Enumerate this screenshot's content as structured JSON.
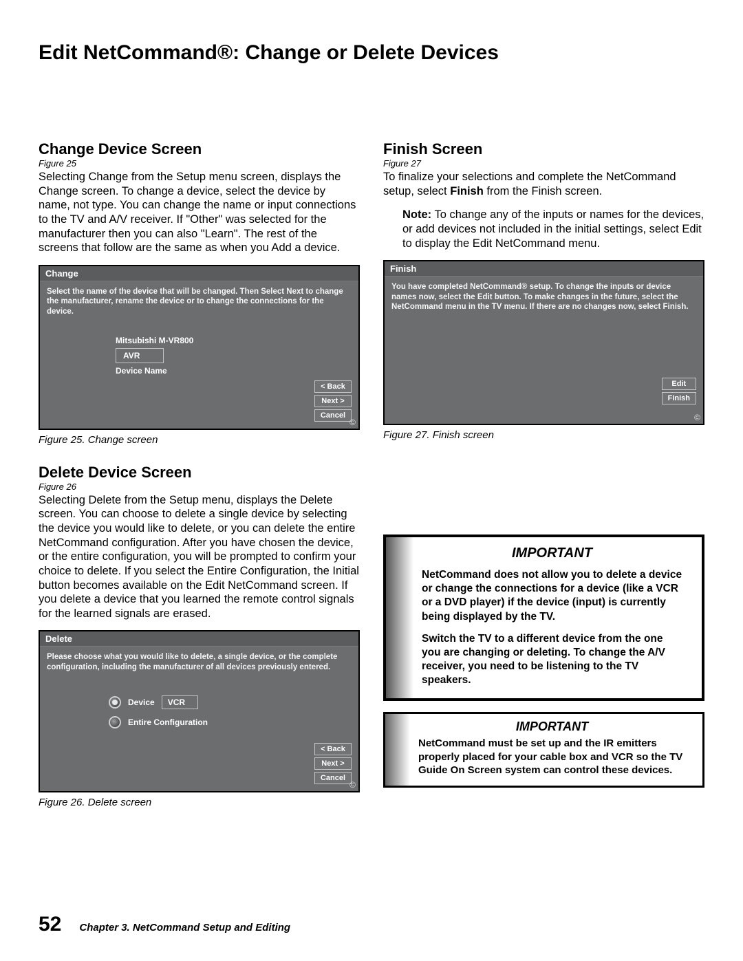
{
  "page_title": "Edit NetCommand®:  Change or Delete Devices",
  "left": {
    "s1": {
      "heading": "Change Device Screen",
      "figref": "Figure 25",
      "body": "Selecting Change from the Setup menu screen, displays the Change screen. To change a device, select the device by name, not type.  You can change the name or input connections to the TV and A/V receiver.  If \"Other\" was selected for the manufacturer then you can also \"Learn\". The rest of the screens that follow are the same as when you Add a device.",
      "screenshot": {
        "title": "Change",
        "instr": "Select the name of the device that will be changed.  Then Select Next to change the manufacturer, rename the device or to change the connections for the device.",
        "device_above": "Mitsubishi M-VR800",
        "input_value": "AVR",
        "field_label": "Device Name",
        "buttons": [
          "< Back",
          "Next >",
          "Cancel"
        ]
      },
      "caption": "Figure 25. Change screen"
    },
    "s2": {
      "heading": "Delete Device Screen",
      "figref": "Figure 26",
      "body": "Selecting Delete from the Setup menu, displays the Delete screen.  You can choose to delete a single device by selecting the device you would like to delete, or you can delete the entire NetCommand configuration.  After you have chosen the device, or the entire configuration, you will be prompted to confirm your choice to delete.  If you select the Entire Configuration, the Initial button becomes available on the Edit NetCommand screen.  If you delete a device that you learned the remote control signals for the learned signals are erased.",
      "screenshot": {
        "title": "Delete",
        "instr": "Please choose what you would like to delete, a single device, or the complete configuration, including the manufacturer of all devices previously entered.",
        "opt1_label": "Device",
        "opt1_value": "VCR",
        "opt2_label": "Entire Configuration",
        "buttons": [
          "< Back",
          "Next >",
          "Cancel"
        ]
      },
      "caption": "Figure 26. Delete screen"
    }
  },
  "right": {
    "s1": {
      "heading": "Finish Screen",
      "figref": "Figure 27",
      "body_pre": "To finalize your selections and complete the NetCommand setup, select ",
      "body_bold": "Finish",
      "body_post": " from the Finish screen.",
      "note_pre": "Note:",
      "note_body": "  To change any of the inputs or names for the devices, or add devices not included in the initial settings, select Edit to display the Edit NetCommand menu.",
      "screenshot": {
        "title": "Finish",
        "instr": "You have completed NetCommand® setup.  To change the inputs or device names now, select the Edit button.  To make changes in the future, select the NetCommand menu in the TV menu.  If there are no changes now, select Finish.",
        "buttons": [
          "Edit",
          "Finish"
        ]
      },
      "caption": "Figure 27. Finish screen"
    },
    "important1": {
      "title": "IMPORTANT",
      "p1": "NetCommand does not allow you to delete a device or change the connections for a device (like a VCR or a DVD player) if the device (input) is currently being displayed by the TV.",
      "p2": "Switch the TV to a different device from the one you are changing or deleting.  To change the A/V receiver, you need to be listening to the TV speakers."
    },
    "important2": {
      "title": "IMPORTANT",
      "p1": "NetCommand must be set up and the IR emitters properly placed for your cable box and VCR so the TV Guide On Screen system can control these devices."
    }
  },
  "footer": {
    "page": "52",
    "chapter": "Chapter 3. NetCommand Setup and Editing"
  }
}
